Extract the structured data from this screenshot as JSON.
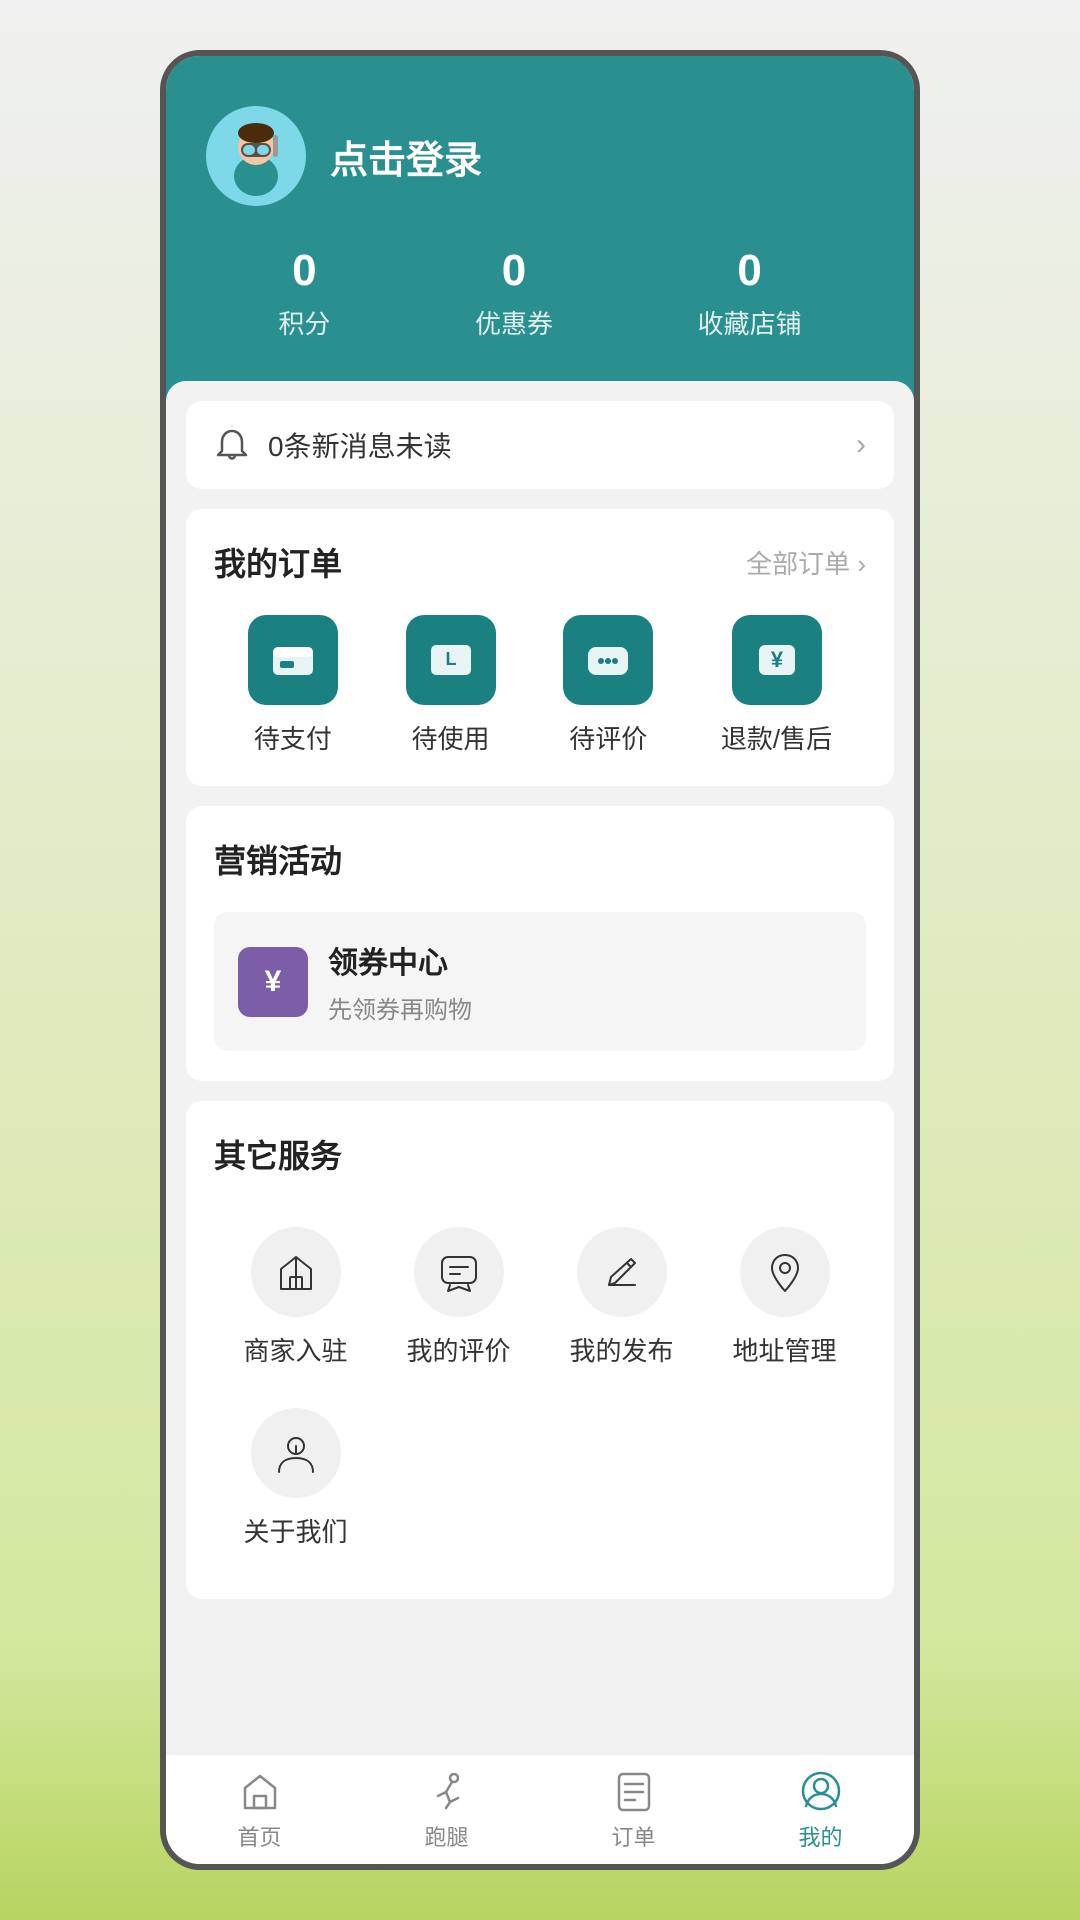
{
  "header": {
    "login_text": "点击登录",
    "stats": [
      {
        "number": "0",
        "label": "积分"
      },
      {
        "number": "0",
        "label": "优惠券"
      },
      {
        "number": "0",
        "label": "收藏店铺"
      }
    ]
  },
  "notification": {
    "text": "0条新消息未读"
  },
  "orders": {
    "title": "我的订单",
    "link": "全部订单",
    "items": [
      {
        "label": "待支付"
      },
      {
        "label": "待使用"
      },
      {
        "label": "待评价"
      },
      {
        "label": "退款/售后"
      }
    ]
  },
  "marketing": {
    "title": "营销活动",
    "coupon": {
      "title": "领券中心",
      "subtitle": "先领券再购物"
    }
  },
  "services": {
    "title": "其它服务",
    "items": [
      {
        "label": "商家入驻"
      },
      {
        "label": "我的评价"
      },
      {
        "label": "我的发布"
      },
      {
        "label": "地址管理"
      },
      {
        "label": "关于我们"
      }
    ]
  },
  "bottom_nav": {
    "items": [
      {
        "label": "首页",
        "active": false
      },
      {
        "label": "跑腿",
        "active": false
      },
      {
        "label": "订单",
        "active": false
      },
      {
        "label": "我的",
        "active": true
      }
    ]
  }
}
